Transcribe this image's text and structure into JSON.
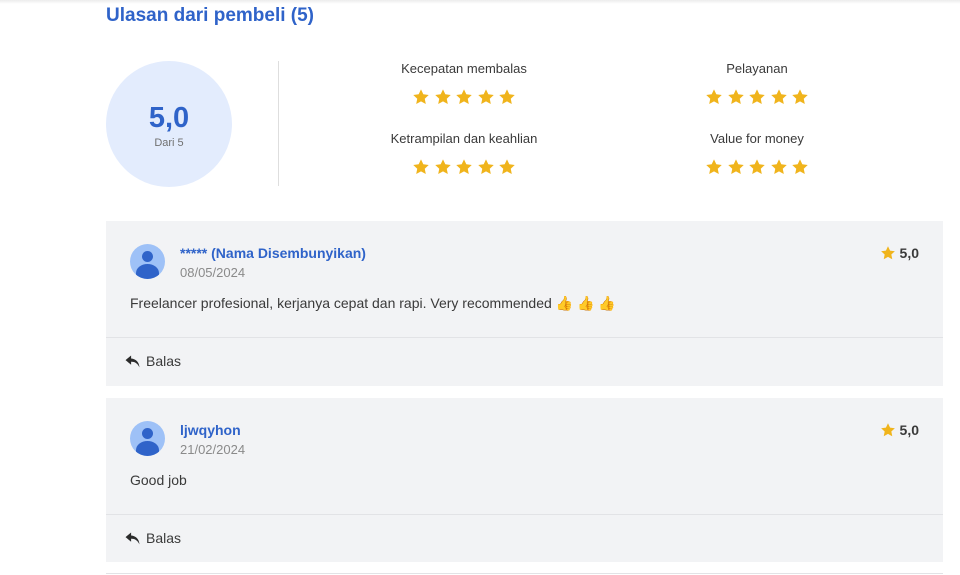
{
  "section_title": "Ulasan dari pembeli (5)",
  "summary": {
    "score": "5,0",
    "out_of": "Dari 5",
    "categories": [
      {
        "label": "Kecepatan membalas",
        "stars": 5
      },
      {
        "label": "Pelayanan",
        "stars": 5
      },
      {
        "label": "Ketrampilan dan keahlian",
        "stars": 5
      },
      {
        "label": "Value for money",
        "stars": 5
      }
    ]
  },
  "reviews": [
    {
      "name": "***** (Nama Disembunyikan)",
      "date": "08/05/2024",
      "rating": "5,0",
      "text": "Freelancer profesional, kerjanya cepat dan rapi. Very recommended 👍 👍 👍",
      "reply_label": "Balas"
    },
    {
      "name": "ljwqyhon",
      "date": "21/02/2024",
      "rating": "5,0",
      "text": "Good job",
      "reply_label": "Balas"
    }
  ],
  "colors": {
    "accent": "#2f63c9",
    "star": "#f0b41c",
    "circle_bg": "#e3ecfd",
    "card_bg": "#f2f3f5"
  },
  "icons": {
    "star": "star-icon",
    "reply": "reply-arrow-icon",
    "avatar": "user-avatar-icon"
  }
}
